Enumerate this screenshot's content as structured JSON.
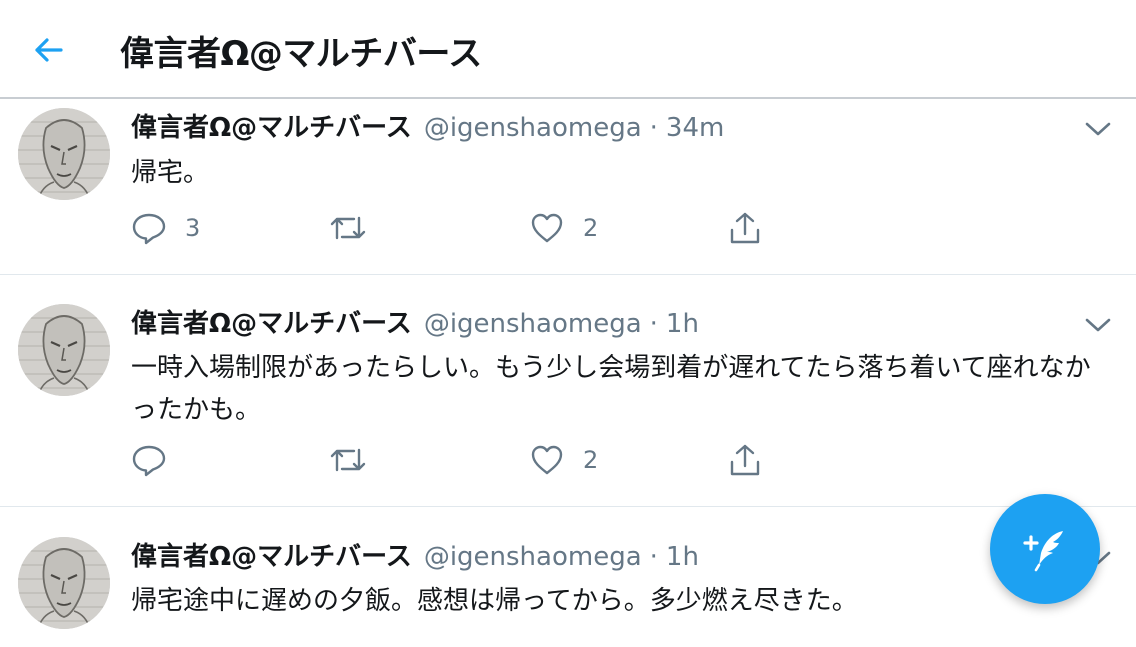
{
  "header": {
    "title": "偉言者Ω@マルチバース"
  },
  "tweets": [
    {
      "name": "偉言者Ω@マルチバース",
      "handle": "@igenshaomega",
      "dot": "·",
      "time": "34m",
      "text": "帰宅。",
      "reply_count": "3",
      "retweet_count": "",
      "like_count": "2"
    },
    {
      "name": "偉言者Ω@マルチバース",
      "handle": "@igenshaomega",
      "dot": "·",
      "time": "1h",
      "text": "一時入場制限があったらしい。もう少し会場到着が遅れてたら落ち着いて座れなかったかも。",
      "reply_count": "",
      "retweet_count": "",
      "like_count": "2"
    },
    {
      "name": "偉言者Ω@マルチバース",
      "handle": "@igenshaomega",
      "dot": "·",
      "time": "1h",
      "text": "帰宅途中に遅めの夕飯。感想は帰ってから。多少燃え尽きた。",
      "reply_count": "",
      "retweet_count": "",
      "like_count": ""
    }
  ],
  "colors": {
    "accent": "#1da1f2",
    "secondary_text": "#657786",
    "primary_text": "#14171a",
    "divider": "#e1e8ed"
  },
  "icons": {
    "back": "arrow-left-icon",
    "caret": "chevron-down-icon",
    "reply": "reply-icon",
    "retweet": "retweet-icon",
    "like": "heart-icon",
    "share": "share-icon",
    "compose": "compose-tweet-icon"
  }
}
